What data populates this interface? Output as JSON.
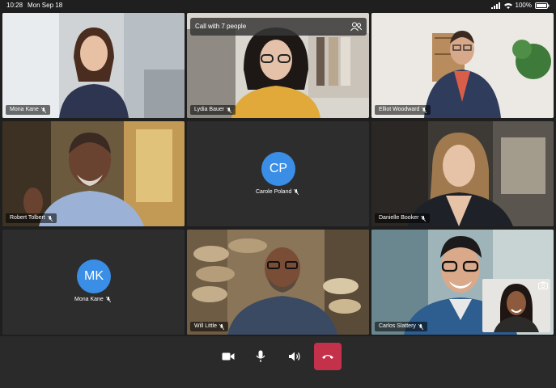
{
  "status": {
    "time": "10:28",
    "date": "Mon Sep 18",
    "battery": "100%"
  },
  "call": {
    "banner": "Call with 7 people"
  },
  "participants": [
    {
      "name": "Mona Kane"
    },
    {
      "name": "Lydia Bauer"
    },
    {
      "name": "Elliot Woodward"
    },
    {
      "name": "Robert Tolbert"
    },
    {
      "name": "Carole Poland",
      "initials": "CP"
    },
    {
      "name": "Danielle Booker"
    },
    {
      "name": "Mona Kane",
      "initials": "MK"
    },
    {
      "name": "Will Little"
    },
    {
      "name": "Carlos Slattery"
    }
  ],
  "controls": {
    "camera_icon": "video-camera-icon",
    "mic_icon": "microphone-icon",
    "speaker_icon": "speaker-icon",
    "hangup_icon": "phone-hangup-icon",
    "hangup_color": "#c4314b"
  },
  "colors": {
    "avatar": "#3a8ee6",
    "background": "#1f1f1f"
  }
}
